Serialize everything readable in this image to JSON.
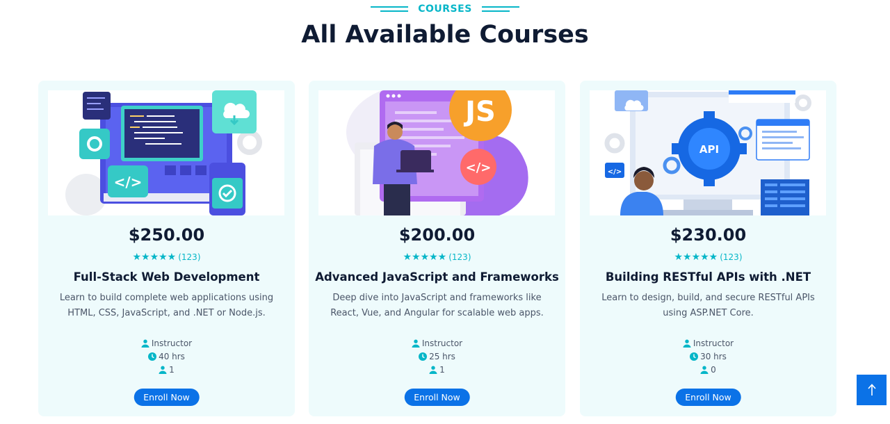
{
  "section": {
    "eyebrow": "COURSES",
    "title": "All Available Courses"
  },
  "colors": {
    "accent": "#06b6c8",
    "primary_button": "#0b72e7",
    "card_bg": "#eefbfc",
    "heading": "#0f1b33"
  },
  "courses": [
    {
      "price": "$250.00",
      "stars": "★★★★★",
      "reviews": "(123)",
      "title": "Full-Stack Web Development",
      "description": "Learn to build complete web applications using HTML, CSS, JavaScript, and .NET or Node.js.",
      "instructor": "Instructor",
      "duration": "40 hrs",
      "students": "1",
      "button": "Enroll Now",
      "image_icon": "web-development-illustration"
    },
    {
      "price": "$200.00",
      "stars": "★★★★★",
      "reviews": "(123)",
      "title": "Advanced JavaScript and Frameworks",
      "description": "Deep dive into JavaScript and frameworks like React, Vue, and Angular for scalable web apps.",
      "instructor": "Instructor",
      "duration": "25 hrs",
      "students": "1",
      "button": "Enroll Now",
      "image_icon": "javascript-illustration",
      "image_text": {
        "badge": "JS",
        "tag": "</>"
      }
    },
    {
      "price": "$230.00",
      "stars": "★★★★★",
      "reviews": "(123)",
      "title": "Building RESTful APIs with .NET",
      "description": "Learn to design, build, and secure RESTful APIs using ASP.NET Core.",
      "instructor": "Instructor",
      "duration": "30 hrs",
      "students": "0",
      "button": "Enroll Now",
      "image_icon": "api-illustration",
      "image_text": {
        "badge": "API",
        "tag": "</>"
      }
    }
  ],
  "back_to_top": {
    "icon": "arrow-up-icon"
  }
}
